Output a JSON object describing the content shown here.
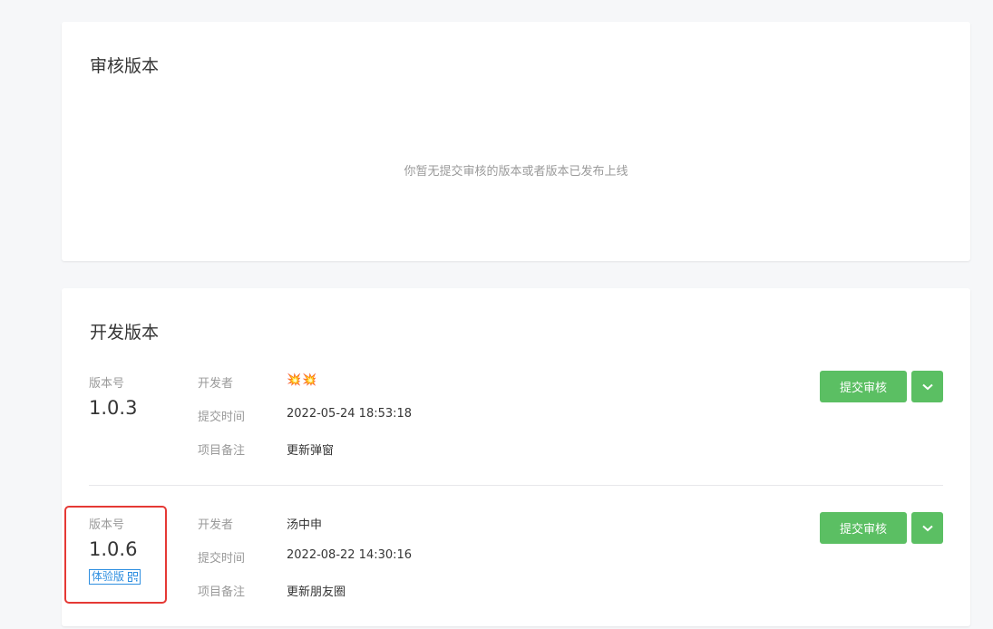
{
  "review_section": {
    "title": "审核版本",
    "empty_text": "你暂无提交审核的版本或者版本已发布上线"
  },
  "dev_section": {
    "title": "开发版本",
    "versions": [
      {
        "version_label": "版本号",
        "version_number": "1.0.3",
        "developer_label": "开发者",
        "developer_value": "💥💥",
        "submit_time_label": "提交时间",
        "submit_time_value": "2022-05-24 18:53:18",
        "note_label": "项目备注",
        "note_value": "更新弹窗",
        "submit_button": "提交审核",
        "more_icon": "chevron-down-icon"
      },
      {
        "version_label": "版本号",
        "version_number": "1.0.6",
        "tag": "体验版",
        "tag_icon": "qr-code-icon",
        "developer_label": "开发者",
        "developer_value": "汤中申",
        "submit_time_label": "提交时间",
        "submit_time_value": "2022-08-22 14:30:16",
        "note_label": "项目备注",
        "note_value": "更新朋友圈",
        "submit_button": "提交审核",
        "more_icon": "chevron-down-icon"
      }
    ]
  },
  "colors": {
    "accent_green": "#5bbf63",
    "tag_blue": "#2f8fe0",
    "highlight_red": "#e53935"
  }
}
